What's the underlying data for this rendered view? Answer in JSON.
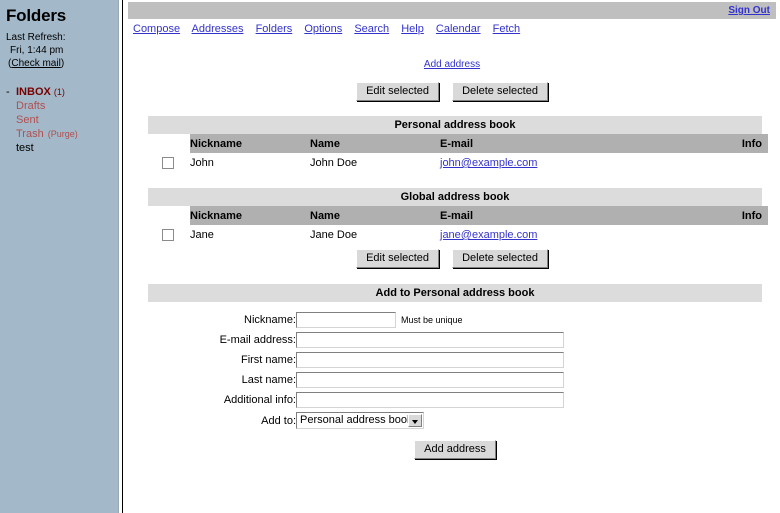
{
  "sidebar": {
    "title": "Folders",
    "last_refresh_label": "Last Refresh:",
    "last_refresh_value": "Fri, 1:44 pm",
    "check_mail_label": "Check mail",
    "check_mail_open": "(",
    "check_mail_close": ")",
    "folders": [
      {
        "name": "INBOX",
        "count": "(1)",
        "dash": "-",
        "style": "inbox"
      },
      {
        "name": "Drafts",
        "count": "",
        "dash": "",
        "style": "normal"
      },
      {
        "name": "Sent",
        "count": "",
        "dash": "",
        "style": "normal"
      },
      {
        "name": "Trash",
        "count": "(Purge)",
        "dash": "",
        "style": "normal"
      },
      {
        "name": "test",
        "count": "",
        "dash": "",
        "style": "plain"
      }
    ]
  },
  "header": {
    "sign_out": "Sign Out",
    "nav": [
      "Compose",
      "Addresses",
      "Folders",
      "Options",
      "Search",
      "Help",
      "Calendar",
      "Fetch"
    ]
  },
  "toolbar": {
    "add_address_link": "Add address",
    "edit_selected": "Edit selected",
    "delete_selected": "Delete selected"
  },
  "columns": {
    "nickname": "Nickname",
    "name": "Name",
    "email": "E-mail",
    "info": "Info"
  },
  "personal_book": {
    "title": "Personal address book",
    "rows": [
      {
        "nickname": "John",
        "name": "John Doe",
        "email": "john@example.com",
        "info": ""
      }
    ]
  },
  "global_book": {
    "title": "Global address book",
    "rows": [
      {
        "nickname": "Jane",
        "name": "Jane Doe",
        "email": "jane@example.com",
        "info": ""
      }
    ],
    "edit_selected": "Edit selected",
    "delete_selected": "Delete selected"
  },
  "add_form": {
    "title": "Add to Personal address book",
    "labels": {
      "nickname": "Nickname:",
      "email": "E-mail address:",
      "first_name": "First name:",
      "last_name": "Last name:",
      "additional_info": "Additional info:",
      "add_to": "Add to:"
    },
    "values": {
      "nickname": "",
      "email": "",
      "first_name": "",
      "last_name": "",
      "additional_info": ""
    },
    "nickname_hint": "Must be unique",
    "add_to_selected": "Personal address book",
    "submit_label": "Add address"
  },
  "colors": {
    "sidebar_bg": "#a3b8c8",
    "link": "#3333cc",
    "inbox": "#770000",
    "folder_link": "#b05050",
    "title_bar": "#dcdcdc",
    "column_header": "#b0b0b0",
    "topbar": "#bfbfbf"
  }
}
